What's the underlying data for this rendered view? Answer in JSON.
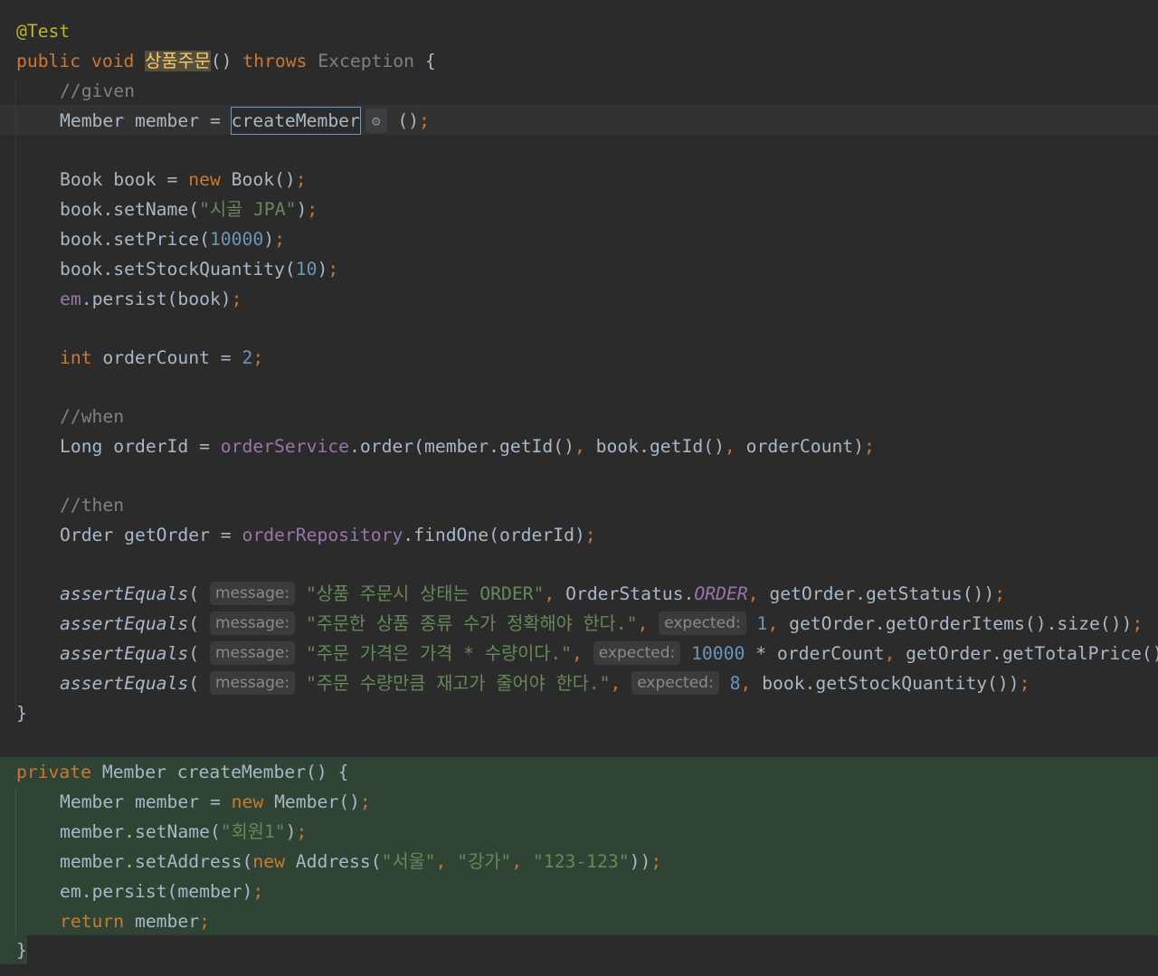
{
  "code": {
    "annotation": "@Test",
    "kw_public": "public",
    "kw_void": "void",
    "method_name": "상품주문",
    "parens": "()",
    "kw_throws": "throws",
    "exception_type": "Exception",
    "open_brace": "{",
    "close_brace": "}",
    "comment_given": "//given",
    "comment_when": "//when",
    "comment_then": "//then",
    "member_decl": "Member member = ",
    "create_member_call": "createMember",
    "call_parens": "()",
    "semicolon": ";",
    "book_decl": "Book book = ",
    "kw_new": "new",
    "book_ctor": "Book()",
    "book_setname": "book.setName(",
    "book_name_str": "\"시골 JPA\"",
    "book_setprice": "book.setPrice(",
    "book_price": "10000",
    "book_setstock": "book.setStockQuantity(",
    "book_stock": "10",
    "close_paren": ")",
    "em": "em",
    "persist_book": ".persist(book)",
    "kw_int": "int",
    "order_count_decl": " orderCount = ",
    "order_count_val": "2",
    "order_id_decl": "Long orderId = ",
    "order_service": "orderService",
    "order_call_a": ".order(member.getId()",
    "comma": ",",
    "order_call_b": " book.getId()",
    "order_call_c": " orderCount)",
    "get_order_decl": "Order getOrder = ",
    "order_repository": "orderRepository",
    "find_one": ".findOne(orderId)",
    "assert_equals": "assertEquals",
    "open_paren": "(",
    "hint_message": "message:",
    "hint_expected": "expected:",
    "a1_msg": "\"상품 주문시 상태는 ORDER\"",
    "a1_status_cls": " OrderStatus.",
    "a1_status_const": "ORDER",
    "a1_actual": " getOrder.getStatus())",
    "a2_msg": "\"주문한 상품 종류 수가 정확해야 한다.\"",
    "a2_expected": "1",
    "a2_actual": " getOrder.getOrderItems().size())",
    "a3_msg": "\"주문 가격은 가격 * 수량이다.\"",
    "a3_expected": "10000",
    "a3_mult": " * orderCount",
    "a3_actual": " getOrder.getTotalPrice())",
    "a4_msg": "\"주문 수량만큼 재고가 줄어야 한다.\"",
    "a4_expected": "8",
    "a4_actual": " book.getStockQuantity())",
    "kw_private": "private",
    "create_member_sig": " Member createMember() {",
    "cm_member_decl": "Member member = ",
    "member_ctor": " Member()",
    "member_setname": "member.setName(",
    "member_name_str": "\"회원1\"",
    "member_setaddress": "member.setAddress(",
    "address_ctor": " Address(",
    "addr_city": "\"서울\"",
    "addr_street": "\"강가\"",
    "addr_zip": "\"123-123\"",
    "address_close": "))",
    "persist_member": ".persist(member)",
    "kw_return": "return",
    "return_val": " member"
  },
  "colors": {
    "background": "#2b2b2b",
    "caret_row": "#323232",
    "extracted_method_bg": "#2f4434",
    "keyword": "#cc7832",
    "annotation": "#bbb529",
    "comment": "#808080",
    "string": "#6a8759",
    "number": "#6897bb",
    "field": "#9876aa",
    "method_decl": "#ffc66d",
    "default_text": "#a9b7c6",
    "rename_outline": "#6f96c2"
  },
  "icons": {
    "rename_settings": "gear-icon"
  },
  "icon_glyphs": {
    "gear": "⚙"
  }
}
